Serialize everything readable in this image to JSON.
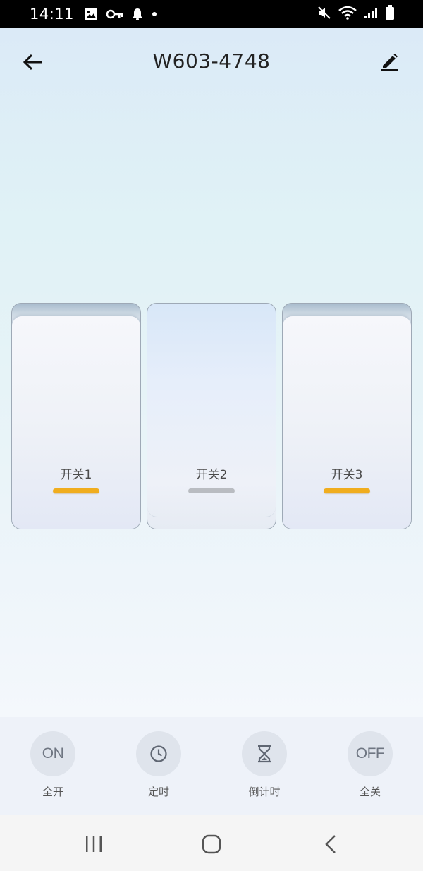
{
  "status_bar": {
    "time": "14:11"
  },
  "header": {
    "title": "W603-4748"
  },
  "switches": [
    {
      "label": "开关1",
      "state": "on"
    },
    {
      "label": "开关2",
      "state": "off"
    },
    {
      "label": "开关3",
      "state": "on"
    }
  ],
  "actions": [
    {
      "icon_text": "ON",
      "label": "全开"
    },
    {
      "icon": "clock-icon",
      "label": "定时"
    },
    {
      "icon": "hourglass-icon",
      "label": "倒计时"
    },
    {
      "icon_text": "OFF",
      "label": "全关"
    }
  ],
  "colors": {
    "indicator_on": "#f0ad1e",
    "indicator_off": "#b9bcc1",
    "status_bar_bg": "#000000"
  }
}
